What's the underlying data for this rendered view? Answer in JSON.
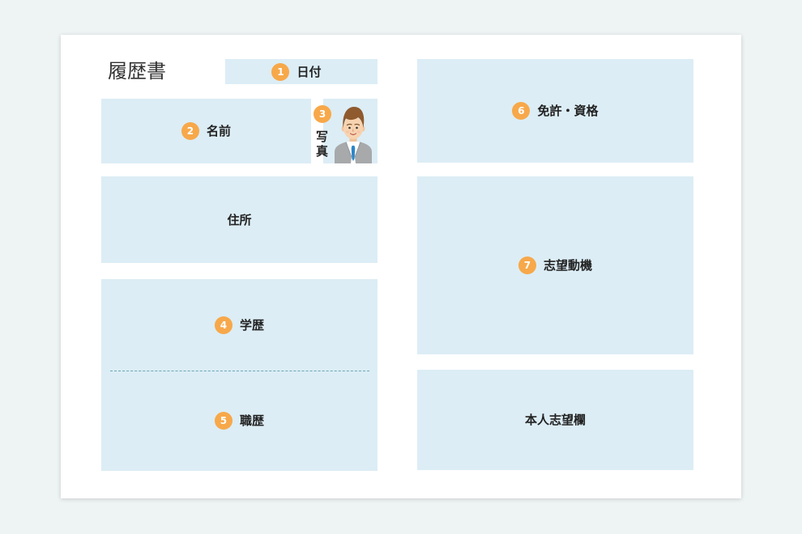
{
  "title": "履歴書",
  "colors": {
    "page_background": "#eef3f4",
    "card": "#ffffff",
    "field_fill": "#dcedf5",
    "badge": "#f7a84a",
    "divider": "#6aa7b5",
    "text": "#222222"
  },
  "fields": {
    "date": {
      "number": "1",
      "label": "日付"
    },
    "name": {
      "number": "2",
      "label": "名前"
    },
    "photo": {
      "number": "3",
      "label_top": "写",
      "label_bottom": "真",
      "icon": "person-avatar-icon"
    },
    "address": {
      "label": "住所"
    },
    "education": {
      "number": "4",
      "label": "学歴"
    },
    "work_history": {
      "number": "5",
      "label": "職歴"
    },
    "licenses": {
      "number": "6",
      "label": "免許・資格"
    },
    "motivation": {
      "number": "7",
      "label": "志望動機"
    },
    "preferences": {
      "label": "本人志望欄"
    }
  }
}
